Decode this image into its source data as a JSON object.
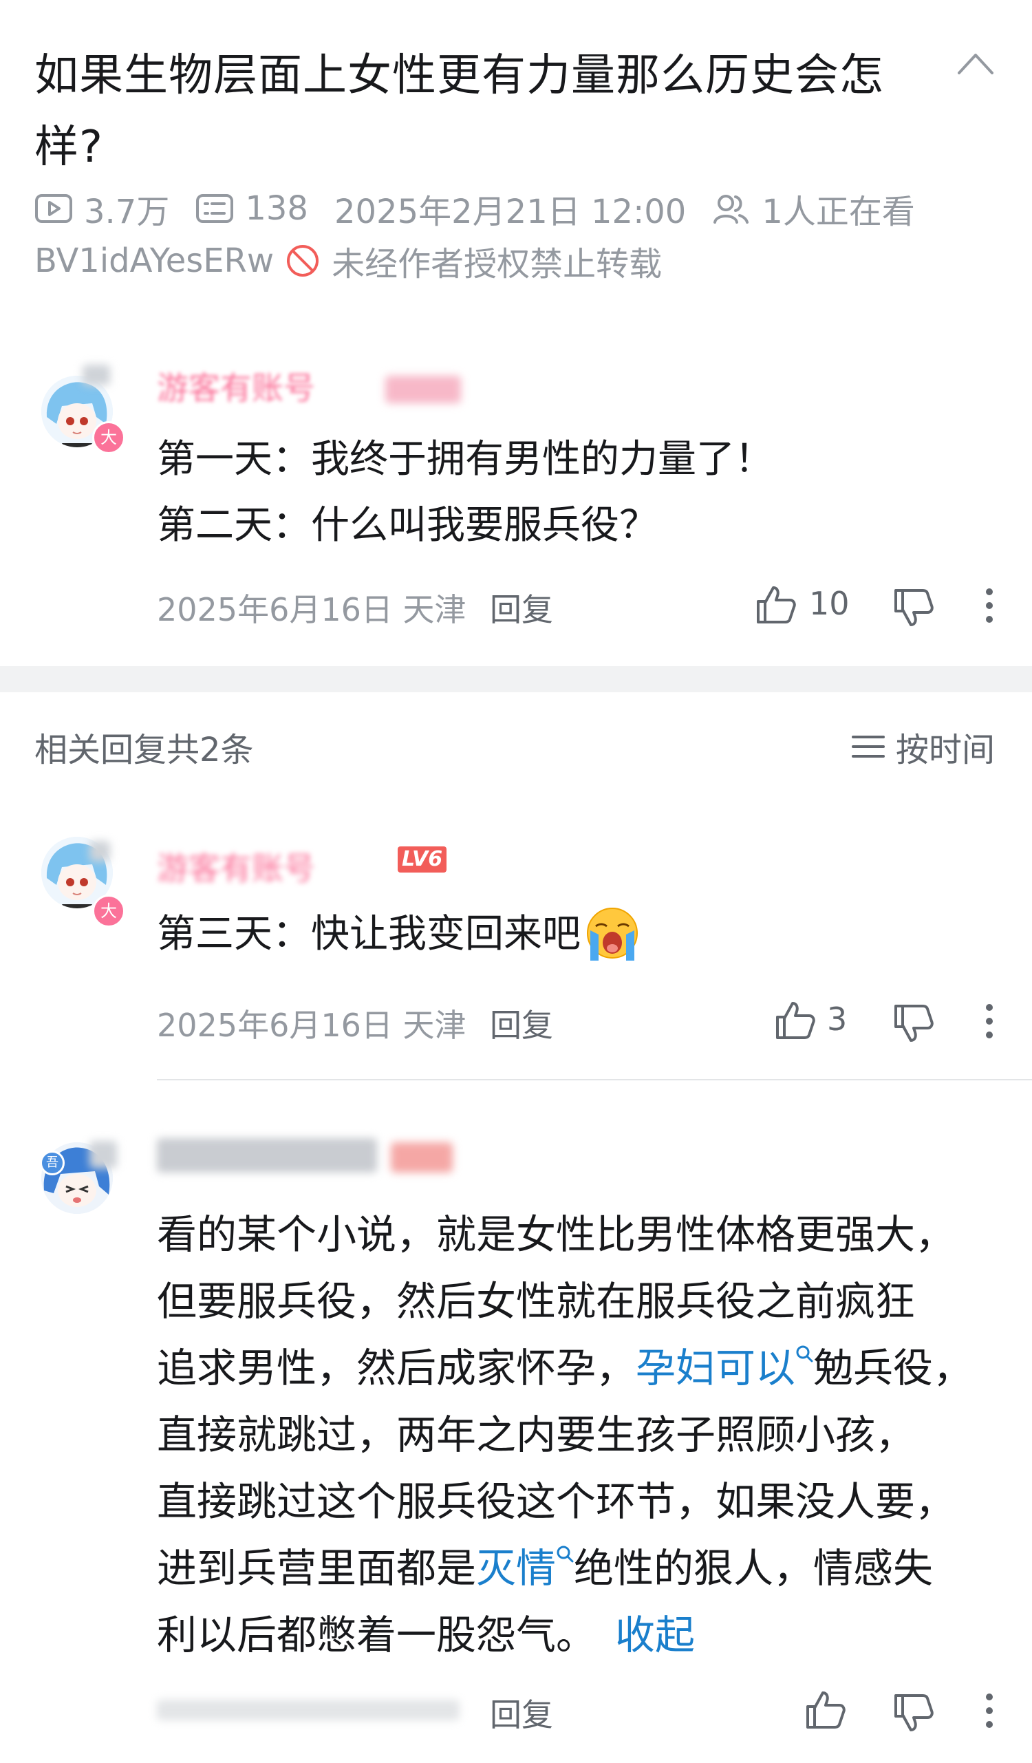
{
  "post": {
    "title_line1": "如果生物层面上女性更有力量那么历史会怎",
    "title_line2": "样?",
    "views": "3.7万",
    "danmaku": "138",
    "date": "2025年2月21日 12:00",
    "watching": "1人正在看",
    "bvid": "BV1idAYesERw",
    "copyright": "未经作者授权禁止转载"
  },
  "main_comment": {
    "username": "游客有账号",
    "avatar_badge": "大",
    "line1": "第一天：我终于拥有男性的力量了！",
    "line2": "第二天：什么叫我要服兵役？",
    "date": "2025年6月16日",
    "location": "天津",
    "reply_label": "回复",
    "likes": "10"
  },
  "replies_header": {
    "label": "相关回复共2条",
    "sort_label": "按时间"
  },
  "reply1": {
    "username": "游客有账号",
    "level": "LV6",
    "avatar_badge": "大",
    "text": "第三天：快让我变回来吧",
    "emoji": "crying-face-emoji",
    "date": "2025年6月16日",
    "location": "天津",
    "reply_label": "回复",
    "likes": "3"
  },
  "reply2": {
    "avatar_badge": "吾",
    "line1": "看的某个小说，就是女性比男性体格更强大，",
    "line2": "但要服兵役，然后女性就在服兵役之前疯狂",
    "line3_a": "追求男性，然后成家怀孕，",
    "line3_link": "孕妇可以",
    "line3_b": "勉兵役，",
    "line4": "直接就跳过，两年之内要生孩子照顾小孩，",
    "line5": "直接跳过这个服兵役这个环节，如果没人要，",
    "line6_a": "进到兵营里面都是",
    "line6_link": "灭情",
    "line6_b": "绝性的狠人，情感失",
    "line7": "利以后都憋着一股怨气。",
    "collapse_label": "收起",
    "reply_label": "回复"
  },
  "colors": {
    "username_pink": "#fb7299",
    "link_blue": "#1a7fcc",
    "meta_gray": "#9499a0"
  }
}
